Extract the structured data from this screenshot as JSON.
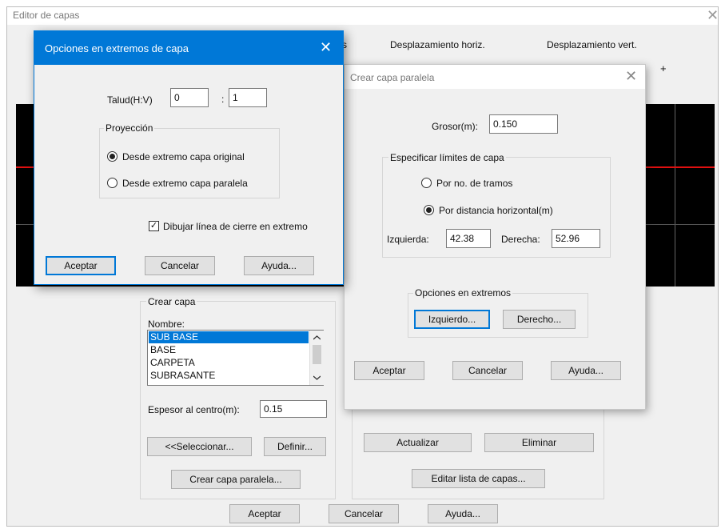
{
  "main": {
    "title": "Editor de capas",
    "close_glyph": "✕",
    "header_cols": [
      "s",
      "Desplazamiento horiz.",
      "Desplazamiento vert."
    ],
    "plus_glyph": "+",
    "crear_capa": {
      "group_label": "Crear capa",
      "nombre_label": "Nombre:",
      "items": [
        "SUB BASE",
        "BASE",
        "CARPETA",
        "SUBRASANTE"
      ],
      "selected_index": 0,
      "espesor_label": "Espesor al centro(m):",
      "espesor_value": "0.15",
      "seleccionar_btn": "<<Seleccionar...",
      "definir_btn": "Definir...",
      "crear_paralela_btn": "Crear capa paralela..."
    },
    "actualizar_btn": "Actualizar",
    "eliminar_btn": "Eliminar",
    "editar_lista_btn": "Editar lista de capas...",
    "aceptar_btn": "Aceptar",
    "cancelar_btn": "Cancelar",
    "ayuda_btn": "Ayuda..."
  },
  "opciones": {
    "title": "Opciones en extremos de capa",
    "close_glyph": "✕",
    "talud_label": "Talud(H:V)",
    "talud_h": "0",
    "colon": ":",
    "talud_v": "1",
    "proyeccion_label": "Proyección",
    "radio1": "Desde extremo capa original",
    "radio2": "Desde extremo capa paralela",
    "radio1_checked": true,
    "check_label": "Dibujar línea de cierre en extremo",
    "check_glyph": "✓",
    "aceptar_btn": "Aceptar",
    "cancelar_btn": "Cancelar",
    "ayuda_btn": "Ayuda..."
  },
  "paralela": {
    "title": "Crear capa paralela",
    "close_glyph": "✕",
    "grosor_label": "Grosor(m):",
    "grosor_value": "0.150",
    "limites_label": "Especificar límites de capa",
    "radio1": "Por no. de tramos",
    "radio2": "Por distancia horizontal(m)",
    "radio2_checked": true,
    "izq_label": "Izquierda:",
    "izq_value": "42.38",
    "der_label": "Derecha:",
    "der_value": "52.96",
    "extremos_label": "Opciones en extremos",
    "izquierdo_btn": "Izquierdo...",
    "derecho_btn": "Derecho...",
    "aceptar_btn": "Aceptar",
    "cancelar_btn": "Cancelar",
    "ayuda_btn": "Ayuda..."
  },
  "colors": {
    "title_active": "#0078d7",
    "canvas": "#000000",
    "red_line": "#e01010",
    "selection": "#0078d7"
  }
}
